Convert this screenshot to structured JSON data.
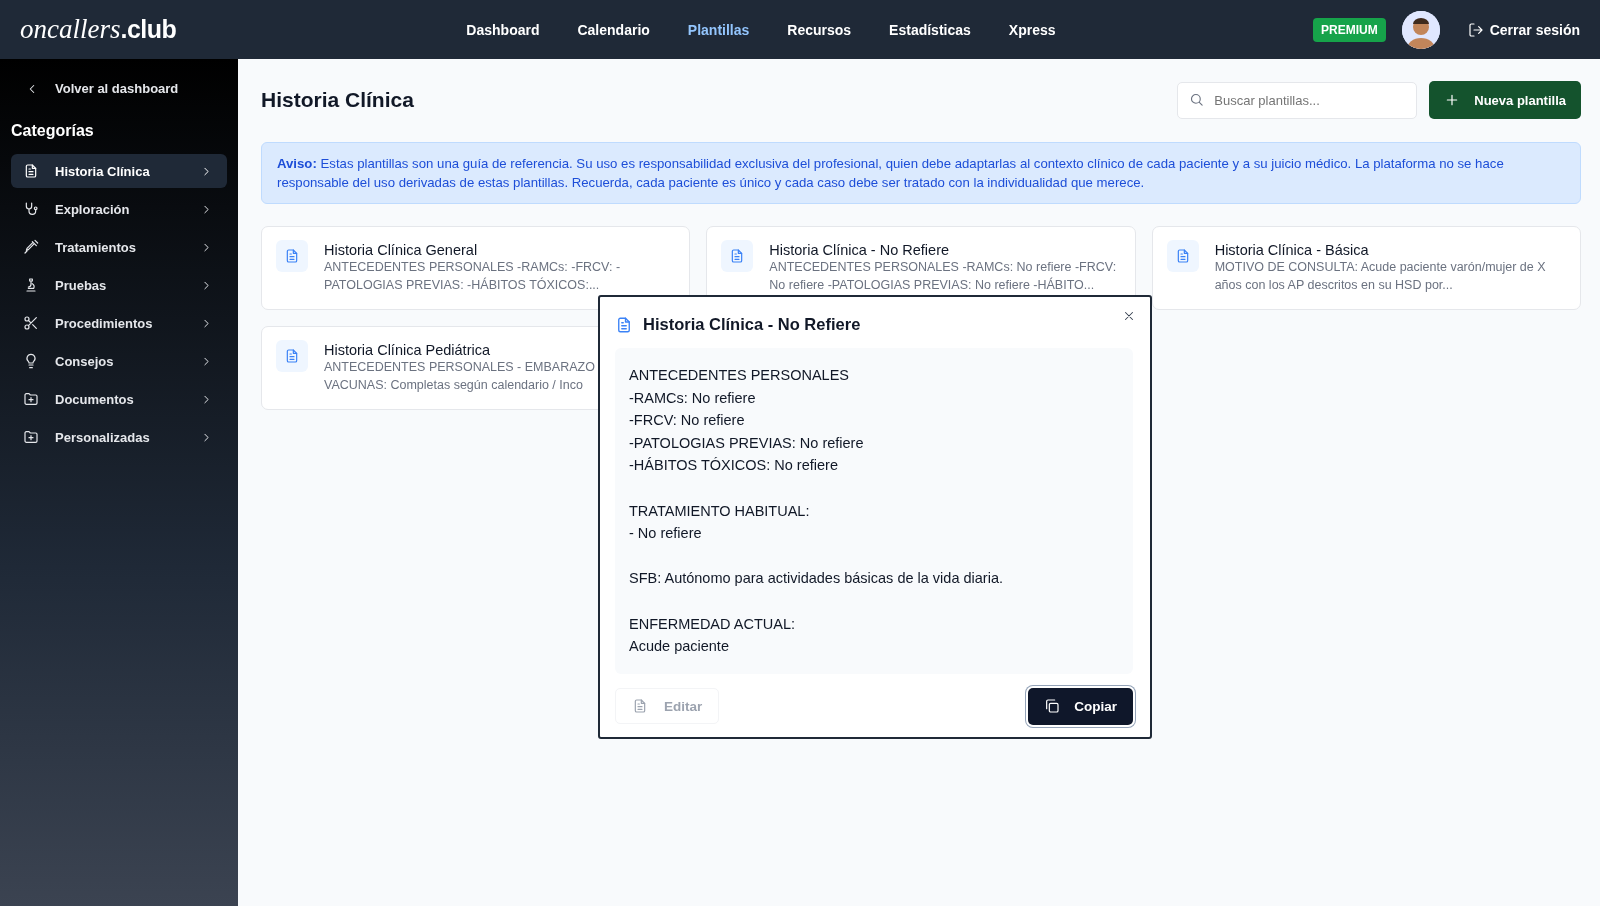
{
  "header": {
    "logo_script": "oncallers",
    "logo_bold": ".club",
    "nav": [
      {
        "label": "Dashboard",
        "selected": false
      },
      {
        "label": "Calendario",
        "selected": false
      },
      {
        "label": "Plantillas",
        "selected": true
      },
      {
        "label": "Recursos",
        "selected": false
      },
      {
        "label": "Estadísticas",
        "selected": false
      },
      {
        "label": "Xpress",
        "selected": false
      }
    ],
    "badge": "PREMIUM",
    "logout": "Cerrar sesión"
  },
  "sidebar": {
    "back": "Volver al dashboard",
    "heading": "Categorías",
    "items": [
      {
        "label": "Historia Clínica",
        "selected": true
      },
      {
        "label": "Exploración",
        "selected": false
      },
      {
        "label": "Tratamientos",
        "selected": false
      },
      {
        "label": "Pruebas",
        "selected": false
      },
      {
        "label": "Procedimientos",
        "selected": false
      },
      {
        "label": "Consejos",
        "selected": false
      },
      {
        "label": "Documentos",
        "selected": false
      },
      {
        "label": "Personalizadas",
        "selected": false
      }
    ]
  },
  "page": {
    "title": "Historia Clínica",
    "search_placeholder": "Buscar plantillas...",
    "new_button": "Nueva plantilla"
  },
  "notice": "**Aviso:** Estas plantillas son una guía de referencia. Su uso es responsabilidad exclusiva del profesional, quien debe adaptarlas al contexto clínico de cada paciente y a su juicio médico. La plataforma no se hace responsable del uso derivadas de estas plantillas. Recuerda, cada paciente es único y cada caso debe ser tratado con la individualidad que merece.",
  "cards": [
    {
      "title": "Historia Clínica General",
      "lines": [
        "ANTECEDENTES PERSONALES -RAMCs: -FRCV: -",
        "PATOLOGIAS PREVIAS: -HÁBITOS TÓXICOS:..."
      ]
    },
    {
      "title": "Historia Clínica - No Refiere",
      "lines": [
        "ANTECEDENTES PERSONALES -RAMCs: No refiere -FRCV:",
        "No refiere -PATOLOGIAS PREVIAS: No refiere -HÁBITO..."
      ]
    },
    {
      "title": "Historia Clínica - Básica",
      "lines": [
        "MOTIVO DE CONSULTA: Acude paciente varón/mujer de X",
        "años con los AP descritos en su HSD por..."
      ]
    },
    {
      "title": "Historia Clínica Pediátrica",
      "lines": [
        "ANTECEDENTES PERSONALES - EMBARAZO",
        "VACUNAS: Completas según calendario / Inco"
      ]
    }
  ],
  "modal": {
    "title": "Historia Clínica - No Refiere",
    "paragraphs": [
      {
        "lines": [
          "ANTECEDENTES PERSONALES",
          "-RAMCs: No refiere",
          "-FRCV: No refiere",
          "-PATOLOGIAS PREVIAS: No refiere",
          "-HÁBITOS TÓXICOS: No refiere"
        ]
      },
      {
        "lines": [
          "TRATAMIENTO HABITUAL:",
          "- No refiere"
        ]
      },
      {
        "lines": [
          "SFB: Autónomo para actividades básicas de la vida diaria."
        ]
      },
      {
        "lines": [
          "ENFERMEDAD ACTUAL:",
          "Acude paciente"
        ]
      }
    ],
    "edit_button": {
      "label": "Editar",
      "disabled": true
    },
    "copy_button": "Copiar"
  }
}
